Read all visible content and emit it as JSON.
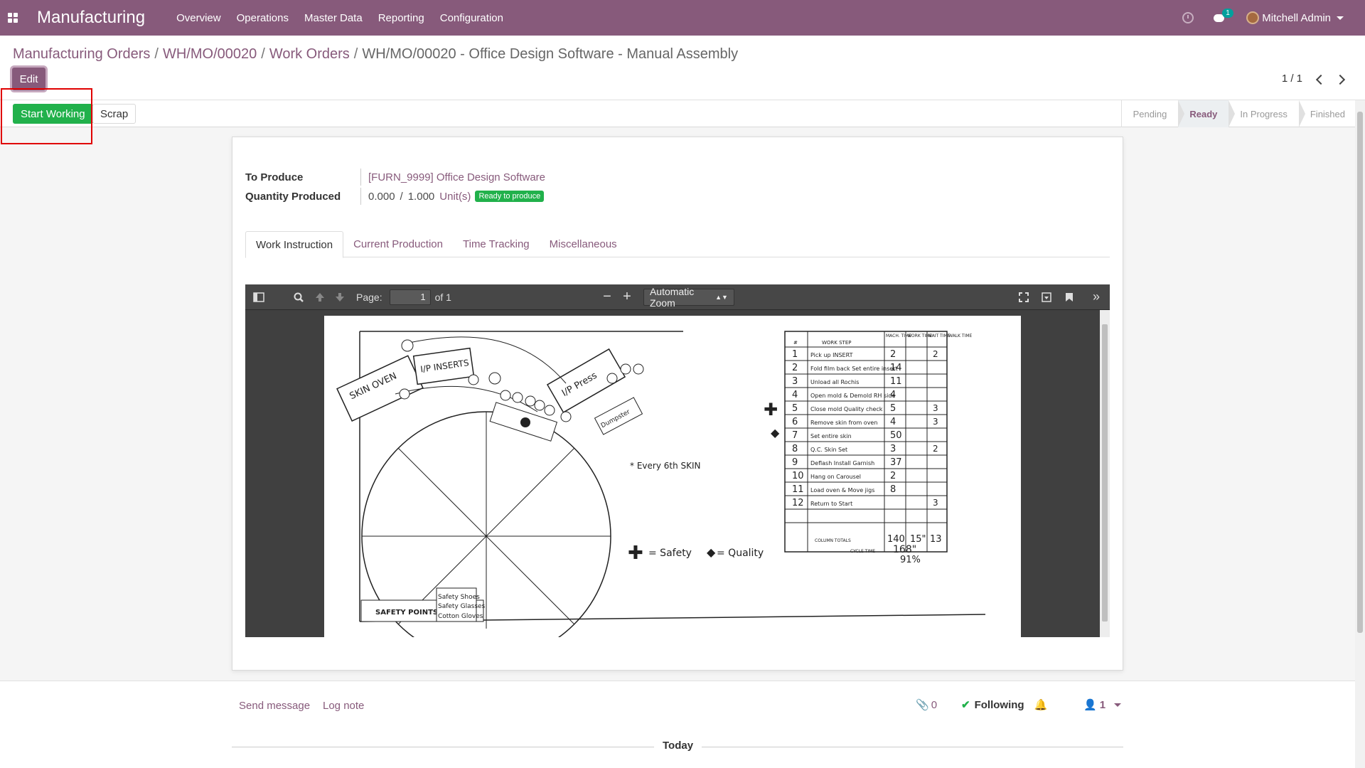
{
  "navbar": {
    "app_name": "Manufacturing",
    "menu": [
      "Overview",
      "Operations",
      "Master Data",
      "Reporting",
      "Configuration"
    ],
    "chat_count": "1",
    "user": "Mitchell Admin",
    "color": "#875a7b"
  },
  "breadcrumb": {
    "items": [
      "Manufacturing Orders",
      "WH/MO/00020",
      "Work Orders"
    ],
    "current": "WH/MO/00020 - Office Design Software - Manual Assembly"
  },
  "actions": {
    "edit": "Edit",
    "start_working": "Start Working",
    "scrap": "Scrap"
  },
  "pager": {
    "value": "1 / 1"
  },
  "stages": {
    "items": [
      "Pending",
      "Ready",
      "In Progress",
      "Finished"
    ],
    "active": "Ready"
  },
  "form": {
    "to_produce_label": "To Produce",
    "to_produce_value": "[FURN_9999] Office Design Software",
    "qty_label": "Quantity Produced",
    "qty_produced": "0.000",
    "qty_sep": "/",
    "qty_total": "1.000",
    "uom": "Unit(s)",
    "ready_badge": "Ready to produce"
  },
  "tabs": [
    "Work Instruction",
    "Current Production",
    "Time Tracking",
    "Miscellaneous"
  ],
  "pdf": {
    "page_label": "Page:",
    "page_value": "1",
    "page_of": "of 1",
    "zoom": "Automatic Zoom",
    "sketch": {
      "skin_oven": "SKIN OVEN",
      "ip_inserts": "I/P INSERTS",
      "ip_press": "I/P Press",
      "dumpster": "Dumpster",
      "safety_points": "SAFETY POINTS",
      "safety_list": [
        "Safety Shoes",
        "Safety Glasses",
        "Cotton Gloves"
      ],
      "every_6th": "* Every 6th SKIN",
      "legend_safety": "= Safety",
      "legend_quality": "= Quality"
    },
    "table": {
      "headers": [
        "#",
        "WORK STEP",
        "MACH. TIME",
        "WORK TIME",
        "WAIT TIME",
        "WALK TIME"
      ],
      "rows": [
        {
          "n": "1",
          "step": "Pick up INSERT",
          "work": "2",
          "walk": "2"
        },
        {
          "n": "2",
          "step": "Fold film back Set entire insert",
          "work": "14",
          "walk": ""
        },
        {
          "n": "3",
          "step": "Unload all Rochis",
          "work": "11",
          "walk": ""
        },
        {
          "n": "4",
          "step": "Open mold & Demold RH side",
          "work": "4",
          "walk": ""
        },
        {
          "n": "5",
          "step": "Close mold Quality check",
          "work": "5",
          "walk": "3"
        },
        {
          "n": "6",
          "step": "Remove skin from oven",
          "work": "4",
          "walk": "3"
        },
        {
          "n": "7",
          "step": "Set entire skin",
          "work": "50",
          "walk": ""
        },
        {
          "n": "8",
          "step": "Q.C. Skin Set",
          "work": "3",
          "walk": "2"
        },
        {
          "n": "9",
          "step": "Deflash Install Garnish",
          "work": "37",
          "walk": ""
        },
        {
          "n": "10",
          "step": "Hang on Carousel",
          "work": "2",
          "walk": ""
        },
        {
          "n": "11",
          "step": "Load oven & Move jigs",
          "work": "8",
          "walk": ""
        },
        {
          "n": "12",
          "step": "Return to Start",
          "work": "",
          "walk": "3"
        }
      ],
      "column_totals_label": "COLUMN TOTALS",
      "totals": [
        "140",
        "15\"",
        "13"
      ],
      "cycle_time_label": "CYCLE TIME",
      "cycle_time": "168\"",
      "percent": "91%"
    }
  },
  "chatter": {
    "send_message": "Send message",
    "log_note": "Log note",
    "attachments": "0",
    "following": "Following",
    "followers": "1",
    "today": "Today"
  }
}
